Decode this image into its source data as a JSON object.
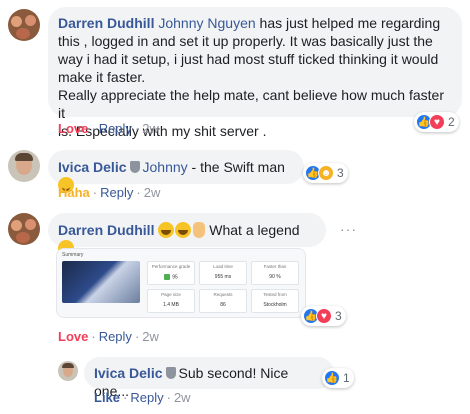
{
  "comments": [
    {
      "author": "Darren Dudhill",
      "tag": "Johnny Nguyen",
      "text_line1": " has just helped me regarding",
      "text_line2": "this , logged in and set it up properly. It was basically just the",
      "text_line3": "way i had it setup, i just had most stuff ticked thinking it would",
      "text_line4": "make it faster.",
      "text_line5": "Really appreciate the help mate, cant believe how much faster it",
      "text_line6": "is. Especially with my shit server .",
      "action_reaction": "Love",
      "action_reply": "Reply",
      "time": "2w",
      "reaction_count": "2"
    },
    {
      "author": "Ivica Delic",
      "tag": "Johnny",
      "text": " - the Swift man",
      "action_reaction": "Haha",
      "action_reply": "Reply",
      "time": "2w",
      "reaction_count": "3"
    },
    {
      "author": "Darren Dudhill",
      "text": "What a legend",
      "action_reaction": "Love",
      "action_reply": "Reply",
      "time": "2w",
      "reaction_count": "3",
      "card": {
        "summary": "Summary",
        "metrics": [
          {
            "label": "Performance grade",
            "value": "95"
          },
          {
            "label": "Load time",
            "value": "955 ms"
          },
          {
            "label": "Faster than",
            "value": "90 %"
          },
          {
            "label": "Page size",
            "value": "1.4 MB"
          },
          {
            "label": "Requests",
            "value": "86"
          },
          {
            "label": "Tested from",
            "value": "Stockholm"
          }
        ]
      }
    },
    {
      "author": "Ivica Delic",
      "text": "Sub second! Nice one...",
      "action_reaction": "Like",
      "action_reply": "Reply",
      "time": "2w",
      "reaction_count": "1"
    }
  ],
  "colors": {
    "link": "#385898",
    "love": "#f33e58",
    "haha": "#f7b125",
    "bubble": "#f2f3f5"
  }
}
